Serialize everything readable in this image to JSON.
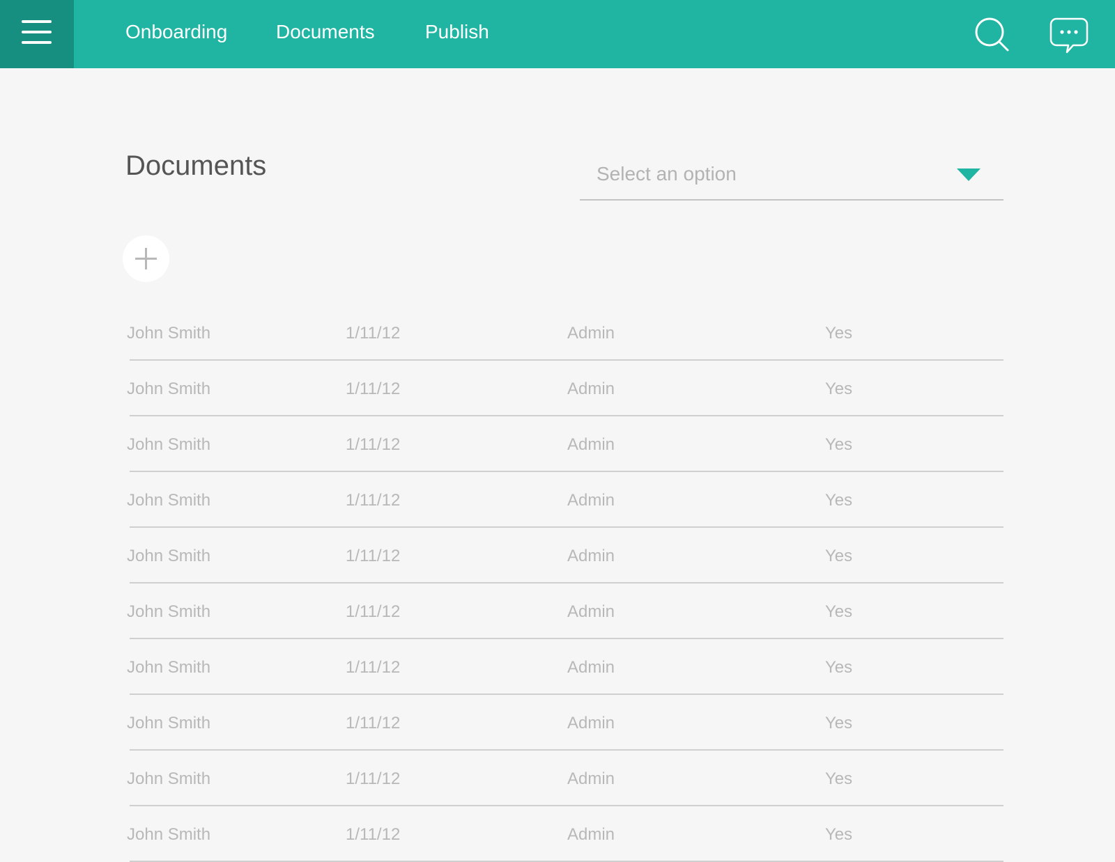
{
  "nav": {
    "menu_icon": "hamburger-menu-icon",
    "links": [
      "Onboarding",
      "Documents",
      "Publish"
    ],
    "search_icon": "search-icon",
    "chat_icon": "chat-bubble-icon"
  },
  "colors": {
    "accent": "#1fb5a2",
    "accent_dark": "#178f80",
    "background": "#f6f6f6"
  },
  "page": {
    "title": "Documents",
    "select_placeholder": "Select an option",
    "select_caret_icon": "caret-down-icon",
    "add_icon": "plus-icon"
  },
  "table": {
    "rows": [
      [
        "John Smith",
        "1/11/12",
        "Admin",
        "Yes"
      ],
      [
        "John Smith",
        "1/11/12",
        "Admin",
        "Yes"
      ],
      [
        "John Smith",
        "1/11/12",
        "Admin",
        "Yes"
      ],
      [
        "John Smith",
        "1/11/12",
        "Admin",
        "Yes"
      ],
      [
        "John Smith",
        "1/11/12",
        "Admin",
        "Yes"
      ],
      [
        "John Smith",
        "1/11/12",
        "Admin",
        "Yes"
      ],
      [
        "John Smith",
        "1/11/12",
        "Admin",
        "Yes"
      ],
      [
        "John Smith",
        "1/11/12",
        "Admin",
        "Yes"
      ],
      [
        "John Smith",
        "1/11/12",
        "Admin",
        "Yes"
      ],
      [
        "John Smith",
        "1/11/12",
        "Admin",
        "Yes"
      ]
    ]
  }
}
